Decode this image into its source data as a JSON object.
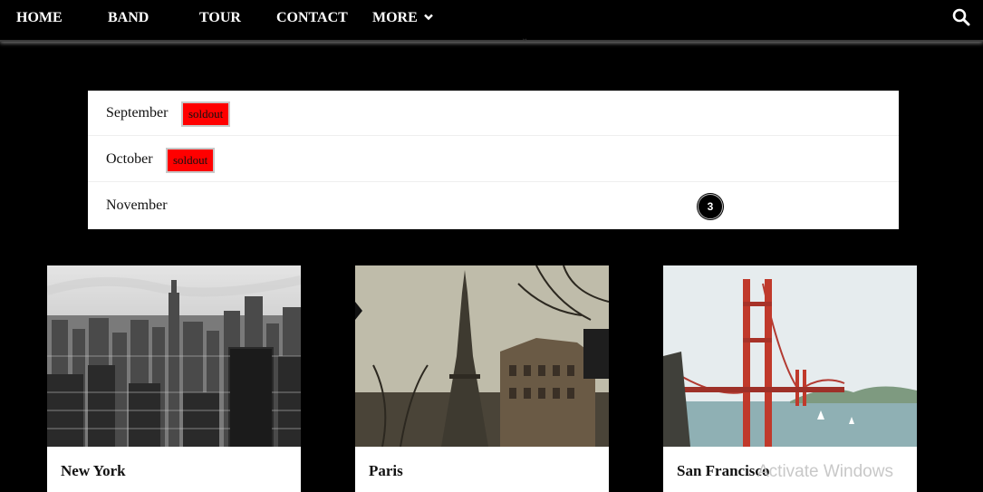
{
  "nav": {
    "items": [
      {
        "label": "HOME"
      },
      {
        "label": "BAND"
      },
      {
        "label": "TOUR"
      },
      {
        "label": "CONTACT"
      },
      {
        "label": "MORE"
      }
    ],
    "search_icon": "search-icon",
    "more_icon": "chevron-down-icon"
  },
  "tickets": {
    "rows": [
      {
        "month": "September",
        "badge": "soldout"
      },
      {
        "month": "October",
        "badge": "soldout"
      },
      {
        "month": "November",
        "count": "3"
      }
    ]
  },
  "cards": [
    {
      "title": "New York",
      "image": "new-york-skyline-photo"
    },
    {
      "title": "Paris",
      "image": "paris-eiffel-tower-photo"
    },
    {
      "title": "San Francisco",
      "image": "golden-gate-bridge-photo"
    }
  ],
  "overlay": {
    "watermark": "Activate Windows"
  },
  "colors": {
    "soldout_bg": "#ff0000",
    "page_bg": "#000000",
    "nav_text": "#ffffff"
  }
}
